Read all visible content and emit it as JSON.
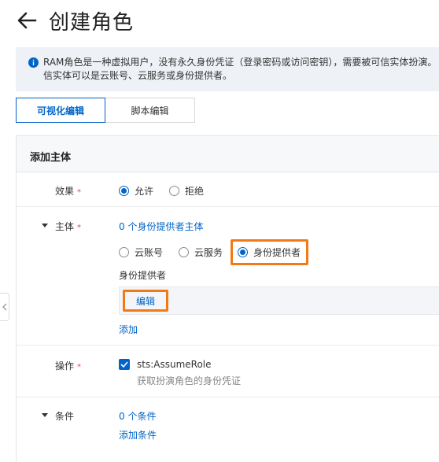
{
  "header": {
    "title": "创建角色"
  },
  "notice": {
    "line1": "RAM角色是一种虚拟用户，没有永久身份凭证（登录密码或访问密钥），需要被可信实体扮演。",
    "line2": "信实体可以是云账号、云服务或身份提供者。"
  },
  "tabs": [
    {
      "label": "可视化编辑",
      "active": true
    },
    {
      "label": "脚本编辑",
      "active": false
    }
  ],
  "panel": {
    "title": "添加主体"
  },
  "effect": {
    "label": "效果",
    "required": "*",
    "options": [
      {
        "label": "允许",
        "selected": true
      },
      {
        "label": "拒绝",
        "selected": false
      }
    ]
  },
  "principal": {
    "label": "主体",
    "required": "*",
    "summary": "0 个身份提供者主体",
    "options": [
      {
        "label": "云账号",
        "selected": false
      },
      {
        "label": "云服务",
        "selected": false
      },
      {
        "label": "身份提供者",
        "selected": true
      }
    ],
    "provider_label": "身份提供者",
    "edit_label": "编辑",
    "add_label": "添加"
  },
  "action": {
    "label": "操作",
    "required": "*",
    "value": "sts:AssumeRole",
    "desc": "获取扮演角色的身份凭证",
    "checked": true
  },
  "condition": {
    "label": "条件",
    "summary": "0 个条件",
    "add_label": "添加条件"
  },
  "colors": {
    "accent": "#0064c8",
    "highlight": "#f07a16",
    "required": "#e0464d"
  }
}
